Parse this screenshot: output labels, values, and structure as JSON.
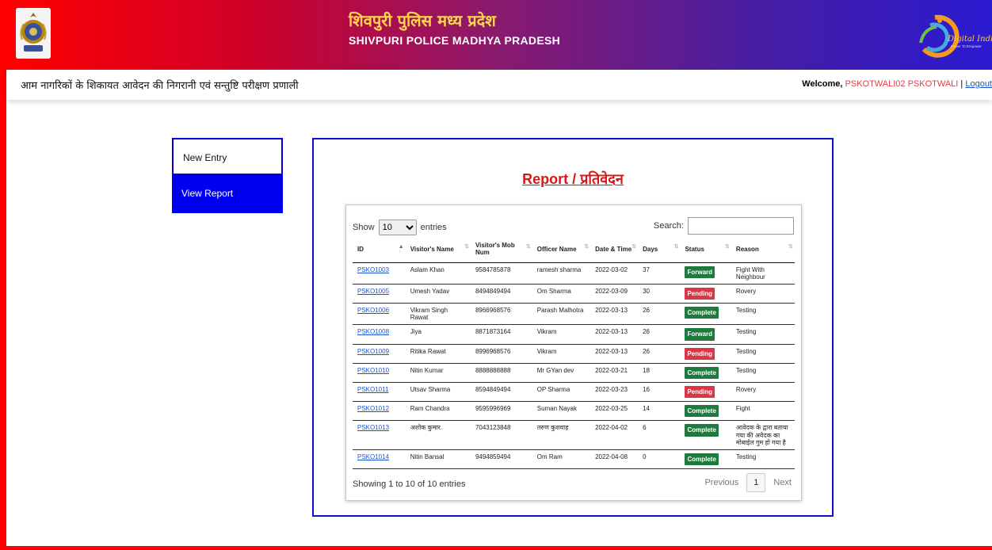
{
  "header": {
    "title_hi": "शिवपुरी पुलिस मध्य प्रदेश",
    "title_en": "SHIVPURI POLICE MADHYA PRADESH",
    "logo_text": "Digital India",
    "logo_tagline": "Power To Empower"
  },
  "subbar": {
    "tagline": "आम नागरिकों के शिकायत आवेदन की निगरानी एवं सन्तुष्टि परीक्षण प्रणाली",
    "welcome_label": "Welcome,",
    "user": "PSKOTWALI02 PSKOTWALI",
    "separator": "|",
    "logout": "Logout"
  },
  "sidebar": {
    "items": [
      {
        "label": "New Entry"
      },
      {
        "label": "View Report"
      }
    ]
  },
  "report": {
    "title": "Report / प्रतिवेदन",
    "show_label": "Show",
    "entries_label": "entries",
    "page_length": "10",
    "search_label": "Search:",
    "search_value": "",
    "columns": [
      "ID",
      "Visitor's Name",
      "Visitor's Mob Num",
      "Officer Name",
      "Date & Time",
      "Days",
      "Status",
      "Reason"
    ],
    "rows": [
      {
        "id": "PSKO1003",
        "name": "Aslam Khan",
        "mob": "9584785878",
        "officer": "ramesh sharma",
        "date": "2022-03-02",
        "days": "37",
        "status": "Forward",
        "reason": "Fight With Neighbour"
      },
      {
        "id": "PSKO1005",
        "name": "Umesh Yadav",
        "mob": "8494849494",
        "officer": "Om Sharma",
        "date": "2022-03-09",
        "days": "30",
        "status": "Pending",
        "reason": "Rovery"
      },
      {
        "id": "PSKO1006",
        "name": "Vikram Singh Rawat",
        "mob": "8966968576",
        "officer": "Parash Malhotra",
        "date": "2022-03-13",
        "days": "26",
        "status": "Complete",
        "reason": "Testing"
      },
      {
        "id": "PSKO1008",
        "name": "Jiya",
        "mob": "8871873164",
        "officer": "Vikram",
        "date": "2022-03-13",
        "days": "26",
        "status": "Forward",
        "reason": "Testing"
      },
      {
        "id": "PSKO1009",
        "name": "Ritika Rawat",
        "mob": "8996968576",
        "officer": "Vikram",
        "date": "2022-03-13",
        "days": "26",
        "status": "Pending",
        "reason": "Testing"
      },
      {
        "id": "PSKO1010",
        "name": "Nitin Kumar",
        "mob": "8888888888",
        "officer": "Mr GYan dev",
        "date": "2022-03-21",
        "days": "18",
        "status": "Complete",
        "reason": "Testing"
      },
      {
        "id": "PSKO1011",
        "name": "Utsav Sharma",
        "mob": "8594849494",
        "officer": "OP Sharma",
        "date": "2022-03-23",
        "days": "16",
        "status": "Pending",
        "reason": "Rovery"
      },
      {
        "id": "PSKO1012",
        "name": "Ram Chandra",
        "mob": "9595996969",
        "officer": "Suman Nayak",
        "date": "2022-03-25",
        "days": "14",
        "status": "Complete",
        "reason": "Fight"
      },
      {
        "id": "PSKO1013",
        "name": "अशोक कुमार.",
        "mob": "7043123848",
        "officer": "तरुण कुशवाह",
        "date": "2022-04-02",
        "days": "6",
        "status": "Complete",
        "reason": "आवेदक के द्वारा बताया गया की अवेदक का मोबाईल गुम हो गया है"
      },
      {
        "id": "PSKO1014",
        "name": "Nitin Bansal",
        "mob": "9494859494",
        "officer": "Om Ram",
        "date": "2022-04-08",
        "days": "0",
        "status": "Complete",
        "reason": "Testing"
      }
    ],
    "info": "Showing 1 to 10 of 10 entries",
    "prev": "Previous",
    "page": "1",
    "next": "Next"
  },
  "colors": {
    "forward": "#1f7a3e",
    "pending": "#dc3545",
    "complete": "#1f7a3e",
    "accent_blue": "#0000f0",
    "title_red": "#d81818"
  }
}
